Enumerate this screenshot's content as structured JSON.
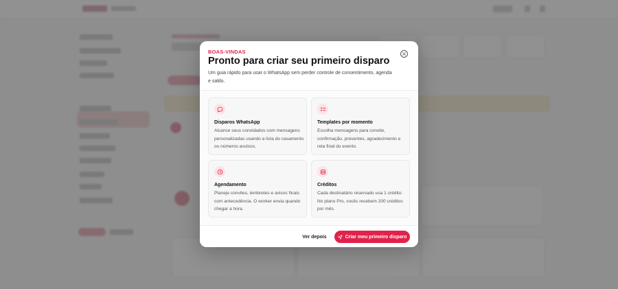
{
  "modal": {
    "eyebrow": "BOAS-VINDAS",
    "title": "Pronto para criar seu primeiro disparo",
    "subtitle": "Um guia rápido para usar o WhatsApp sem perder controle de consentimento, agenda e saldo.",
    "close_icon": "close-icon",
    "features": [
      {
        "icon": "chat-bubble-icon",
        "title": "Disparos WhatsApp",
        "description": "Alcance seus convidados com mensagens personalizadas usando a lista do casamento ou números avulsos."
      },
      {
        "icon": "checklist-icon",
        "title": "Templates por momento",
        "description": "Escolha mensagens para convite, confirmação, presentes, agradecimento e reta final do evento."
      },
      {
        "icon": "clock-icon",
        "title": "Agendamento",
        "description": "Planeje convites, lembretes e avisos finais com antecedência. O worker envia quando chegar a hora."
      },
      {
        "icon": "database-icon",
        "title": "Créditos",
        "description": "Cada destinatário reservado usa 1 crédito. No plano Pro, vocês recebem 200 créditos por mês."
      }
    ],
    "later_label": "Ver depois",
    "primary_label": "Criar meu primeiro disparo",
    "accent_color": "#e2224a"
  }
}
